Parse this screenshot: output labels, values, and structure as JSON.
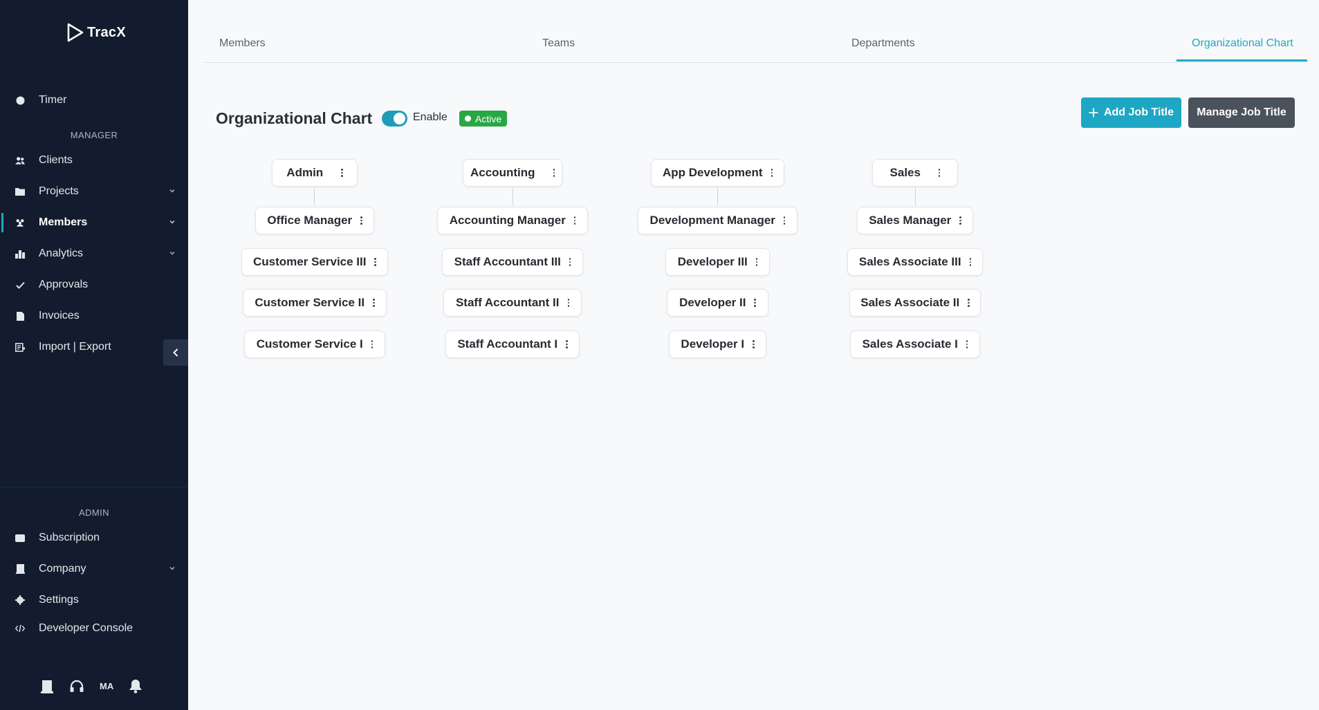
{
  "app": {
    "logo_text": "TracX"
  },
  "sidebar": {
    "timer": "Timer",
    "manager_label": "MANAGER",
    "manager_items": [
      {
        "label": "Clients",
        "icon": "users-icon"
      },
      {
        "label": "Projects",
        "icon": "folder-icon",
        "expandable": true
      },
      {
        "label": "Members",
        "icon": "members-icon",
        "expandable": true,
        "active": true
      },
      {
        "label": "Analytics",
        "icon": "bar-chart-icon",
        "expandable": true
      },
      {
        "label": "Approvals",
        "icon": "check-icon"
      },
      {
        "label": "Invoices",
        "icon": "document-icon"
      },
      {
        "label": "Import | Export",
        "icon": "import-export-icon"
      }
    ],
    "admin_label": "ADMIN",
    "admin_items": [
      {
        "label": "Subscription",
        "icon": "subscription-icon"
      },
      {
        "label": "Company",
        "icon": "building-icon",
        "expandable": true
      },
      {
        "label": "Settings",
        "icon": "gear-icon"
      },
      {
        "label": "Developer Console",
        "icon": "code-icon"
      }
    ],
    "footer": {
      "initials": "MA"
    }
  },
  "tabs": [
    {
      "label": "Members",
      "active": false
    },
    {
      "label": "Teams",
      "active": false
    },
    {
      "label": "Departments",
      "active": false
    },
    {
      "label": "Organizational Chart",
      "active": true
    }
  ],
  "header": {
    "title": "Organizational Chart",
    "toggle_label": "Enable",
    "toggle_on": true,
    "status_badge": "Active",
    "add_button": "Add Job Title",
    "manage_button": "Manage Job Title"
  },
  "org_chart": {
    "departments": [
      {
        "name": "Admin",
        "roles": [
          "Office Manager",
          "Customer Service III",
          "Customer Service II",
          "Customer Service I"
        ]
      },
      {
        "name": "Accounting",
        "roles": [
          "Accounting Manager",
          "Staff Accountant III",
          "Staff Accountant II",
          "Staff Accountant I"
        ]
      },
      {
        "name": "App Development",
        "roles": [
          "Development Manager",
          "Developer III",
          "Developer II",
          "Developer I"
        ]
      },
      {
        "name": "Sales",
        "roles": [
          "Sales Manager",
          "Sales Associate III",
          "Sales Associate II",
          "Sales Associate I"
        ]
      }
    ]
  },
  "colors": {
    "sidebar_bg": "#131c2e",
    "accent": "#1ea7c5",
    "success": "#28a745",
    "secondary_button": "#4a525c"
  }
}
